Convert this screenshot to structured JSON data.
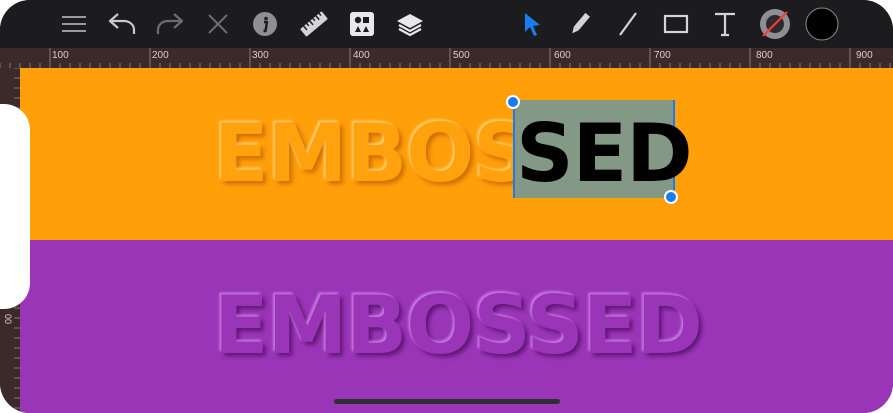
{
  "toolbar": {
    "icons": [
      "menu-icon",
      "undo-icon",
      "redo-icon",
      "close-icon",
      "info-icon",
      "ruler-icon",
      "shapes-icon",
      "layers-icon",
      "select-arrow-icon",
      "pencil-icon",
      "line-icon",
      "rectangle-icon",
      "text-icon",
      "stroke-color-icon",
      "fill-color-icon"
    ],
    "active_tool": "select-arrow-icon",
    "accent_color": "#1b7cf0",
    "fill_color": "#000000"
  },
  "ruler": {
    "top_labels": [
      "100",
      "200",
      "300",
      "400",
      "500",
      "600",
      "700",
      "800",
      "900"
    ],
    "left_label": "00"
  },
  "canvas": {
    "orange_band": {
      "color": "#ff9f0a",
      "text_unselected": "EMBOS",
      "text_selected": "SED"
    },
    "purple_band": {
      "color": "#9b35b8",
      "text": "EMBOSSED"
    },
    "selection_color": "#849985"
  }
}
